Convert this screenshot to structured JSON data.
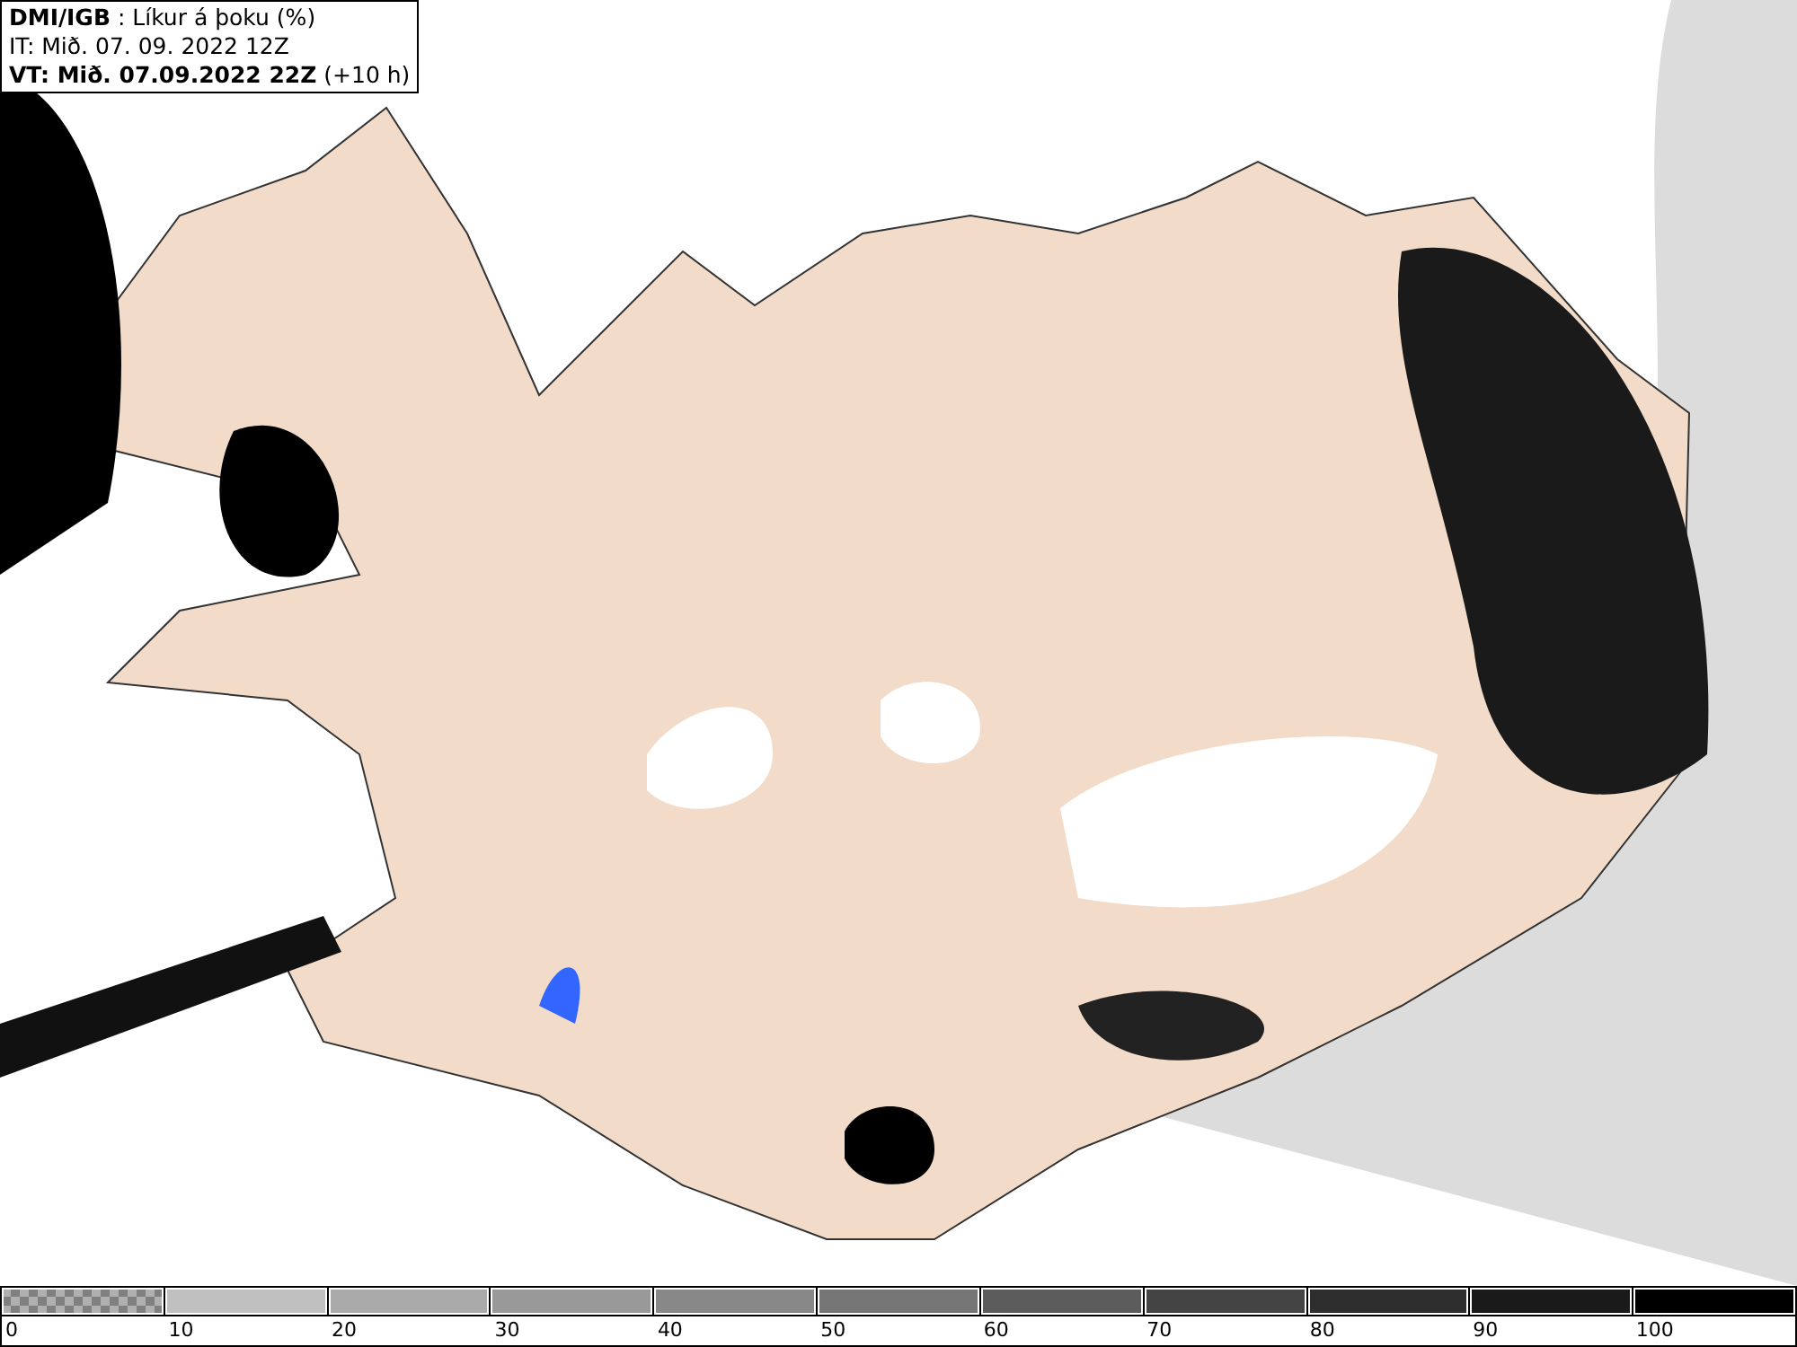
{
  "info_box": {
    "lines": [
      "**DMI/IGB** : Líkur á þoku (%)",
      "IT: Mið. 07. 09. 2022 12Z",
      "**VT: Mið. 07.09.2022 22Z** (+10 h)"
    ]
  },
  "colorbar": {
    "segments": [
      {
        "label": "0",
        "kind": "checkered",
        "color": "#808080"
      },
      {
        "label": "10",
        "kind": "solid",
        "color": "#c0c0c0"
      },
      {
        "label": "20",
        "kind": "solid",
        "color": "#aaaaaa"
      },
      {
        "label": "30",
        "kind": "solid",
        "color": "#999999"
      },
      {
        "label": "40",
        "kind": "solid",
        "color": "#888888"
      },
      {
        "label": "50",
        "kind": "solid",
        "color": "#767676"
      },
      {
        "label": "60",
        "kind": "solid",
        "color": "#5c5c5c"
      },
      {
        "label": "70",
        "kind": "solid",
        "color": "#444444"
      },
      {
        "label": "80",
        "kind": "solid",
        "color": "#2e2e2e"
      },
      {
        "label": "90",
        "kind": "solid",
        "color": "#1a1a1a"
      },
      {
        "label": "100",
        "kind": "solid",
        "color": "#000000"
      }
    ]
  }
}
